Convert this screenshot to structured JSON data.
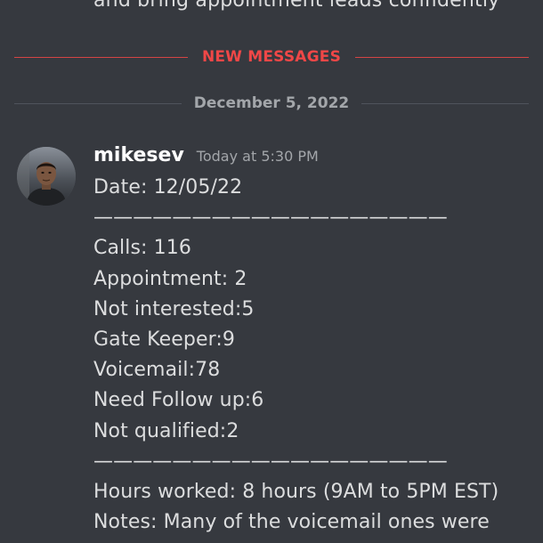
{
  "previous_message": {
    "text": "and bring appointment leads confidently"
  },
  "dividers": {
    "new_messages": "NEW MESSAGES",
    "date": "December 5, 2022"
  },
  "message": {
    "username": "mikesev",
    "timestamp": "Today at 5:30 PM",
    "lines": [
      "Date: 12/05/22",
      "——————————————————",
      "Calls: 116",
      "Appointment: 2",
      "Not interested:5",
      "Gate Keeper:9",
      "Voicemail:78",
      "Need Follow up:6",
      "Not qualified:2",
      "——————————————————",
      "Hours worked: 8 hours (9AM to 5PM EST)",
      "Notes: Many of the voicemail ones were"
    ]
  },
  "colors": {
    "background": "#36393f",
    "new_messages_accent": "#f04747",
    "date_label": "#a3a6aa",
    "username": "#ffffff",
    "body_text": "#dcddde"
  }
}
